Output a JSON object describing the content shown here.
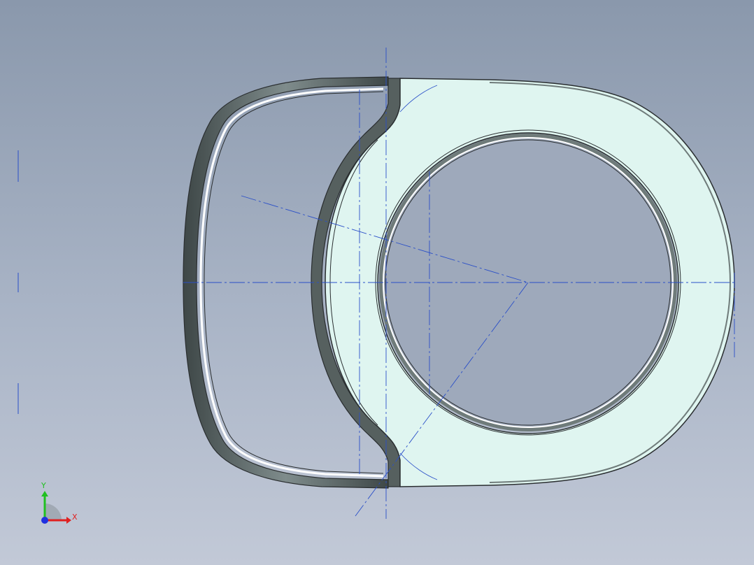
{
  "viewport": {
    "background_top": "#8a98ac",
    "background_bottom": "#c2c9d7"
  },
  "part": {
    "face_color": "#dff5f0",
    "edge_color": "#2a2e30",
    "wall_dark": "#4f5a5a",
    "centerline_color": "#2a4fc8"
  },
  "triad": {
    "x_label": "X",
    "y_label": "Y",
    "x_color": "#e02020",
    "y_color": "#20c020",
    "origin_color": "#2030e0"
  }
}
